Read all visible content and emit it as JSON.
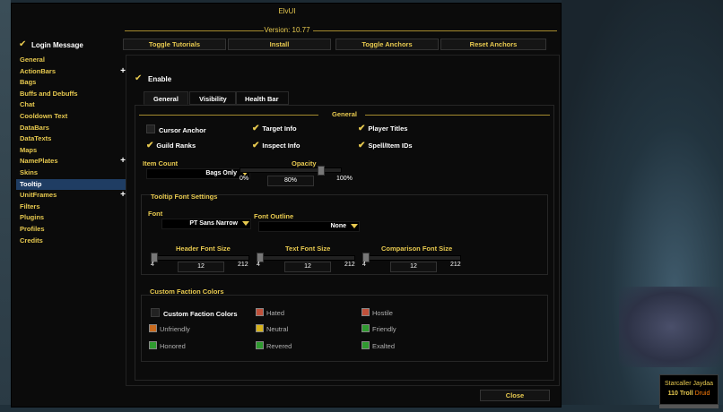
{
  "window": {
    "title": "ElvUI",
    "version": "Version: 10.77"
  },
  "top": {
    "login_label": "Login Message",
    "buttons": [
      "Toggle Tutorials",
      "Install",
      "Toggle Anchors",
      "Reset Anchors"
    ]
  },
  "sidebar": {
    "items": [
      {
        "label": "General",
        "plus": ""
      },
      {
        "label": "ActionBars",
        "plus": "+"
      },
      {
        "label": "Bags",
        "plus": ""
      },
      {
        "label": "Buffs and Debuffs",
        "plus": ""
      },
      {
        "label": "Chat",
        "plus": ""
      },
      {
        "label": "Cooldown Text",
        "plus": ""
      },
      {
        "label": "DataBars",
        "plus": ""
      },
      {
        "label": "DataTexts",
        "plus": ""
      },
      {
        "label": "Maps",
        "plus": ""
      },
      {
        "label": "NamePlates",
        "plus": "+"
      },
      {
        "label": "Skins",
        "plus": ""
      },
      {
        "label": "Tooltip",
        "plus": "",
        "selected": true
      },
      {
        "label": "UnitFrames",
        "plus": "+"
      },
      {
        "label": "Filters",
        "plus": ""
      },
      {
        "label": "Plugins",
        "plus": ""
      },
      {
        "label": "Profiles",
        "plus": ""
      },
      {
        "label": "Credits",
        "plus": ""
      }
    ]
  },
  "content": {
    "enable_label": "Enable",
    "tabs": [
      "General",
      "Visibility",
      "Health Bar"
    ],
    "general_header": "General",
    "checkboxes": {
      "cursor_anchor": "Cursor Anchor",
      "target_info": "Target Info",
      "player_titles": "Player Titles",
      "guild_ranks": "Guild Ranks",
      "inspect_info": "Inspect Info",
      "spell_item_ids": "Spell/Item IDs"
    },
    "item_count": {
      "label": "Item Count",
      "value": "Bags Only"
    },
    "opacity": {
      "label": "Opacity",
      "value": "80%",
      "min": "0%",
      "max": "100%",
      "fraction": 0.8
    },
    "font_settings": {
      "header": "Tooltip Font Settings",
      "font_label": "Font",
      "font_value": "PT Sans Narrow",
      "outline_label": "Font Outline",
      "outline_value": "None",
      "header_size": {
        "label": "Header Font Size",
        "value": "12",
        "min": "4",
        "max": "212"
      },
      "text_size": {
        "label": "Text Font Size",
        "value": "12",
        "min": "4",
        "max": "212"
      },
      "comparison_size": {
        "label": "Comparison Font Size",
        "value": "12",
        "min": "4",
        "max": "212"
      }
    },
    "faction": {
      "header": "Custom Faction Colors",
      "toggle_label": "Custom Faction Colors",
      "items": [
        {
          "label": "Hated",
          "color": "#c0503a"
        },
        {
          "label": "Hostile",
          "color": "#c0503a"
        },
        {
          "label": "Unfriendly",
          "color": "#c86a1e"
        },
        {
          "label": "Neutral",
          "color": "#d6b21a"
        },
        {
          "label": "Friendly",
          "color": "#2f9a2f"
        },
        {
          "label": "Honored",
          "color": "#2f9a2f"
        },
        {
          "label": "Revered",
          "color": "#2f9a2f"
        },
        {
          "label": "Exalted",
          "color": "#2f9a2f"
        }
      ]
    }
  },
  "close_label": "Close",
  "unit_tooltip": {
    "name": "Starcaller Jaydaa",
    "level": "110",
    "race": "Troll",
    "class": "Druid"
  },
  "colors": {
    "accent": "#e7c94f",
    "selected": "#1f3d63"
  }
}
